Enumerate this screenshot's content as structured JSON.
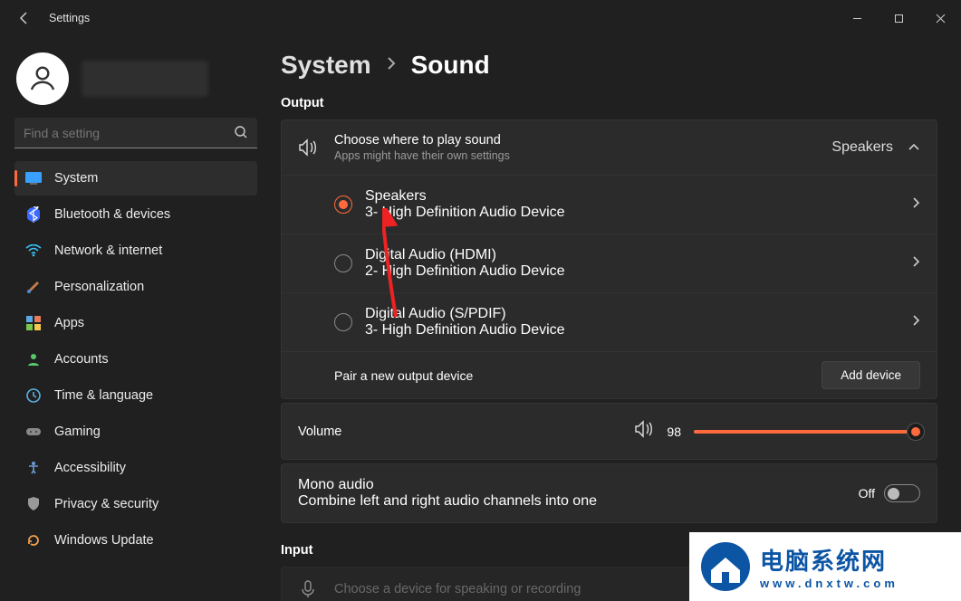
{
  "window": {
    "title": "Settings"
  },
  "search": {
    "placeholder": "Find a setting"
  },
  "nav": {
    "items": [
      {
        "label": "System"
      },
      {
        "label": "Bluetooth & devices"
      },
      {
        "label": "Network & internet"
      },
      {
        "label": "Personalization"
      },
      {
        "label": "Apps"
      },
      {
        "label": "Accounts"
      },
      {
        "label": "Time & language"
      },
      {
        "label": "Gaming"
      },
      {
        "label": "Accessibility"
      },
      {
        "label": "Privacy & security"
      },
      {
        "label": "Windows Update"
      }
    ],
    "active_index": 0
  },
  "breadcrumb": {
    "root": "System",
    "leaf": "Sound"
  },
  "output": {
    "heading": "Output",
    "choose": {
      "title": "Choose where to play sound",
      "sub": "Apps might have their own settings",
      "selected": "Speakers"
    },
    "devices": [
      {
        "name": "Speakers",
        "desc": "3- High Definition Audio Device",
        "selected": true
      },
      {
        "name": "Digital Audio (HDMI)",
        "desc": "2- High Definition Audio Device",
        "selected": false
      },
      {
        "name": "Digital Audio (S/PDIF)",
        "desc": "3- High Definition Audio Device",
        "selected": false
      }
    ],
    "pair_label": "Pair a new output device",
    "add_button": "Add device"
  },
  "volume": {
    "label": "Volume",
    "value": 98
  },
  "mono": {
    "title": "Mono audio",
    "sub": "Combine left and right audio channels into one",
    "state_label": "Off",
    "on": false
  },
  "input": {
    "heading": "Input",
    "choose_title_partial": "Choose a device for speaking or recording"
  },
  "watermark": {
    "cn": "电脑系统网",
    "url": "www.dnxtw.com"
  },
  "colors": {
    "accent": "#ff6a3c"
  }
}
